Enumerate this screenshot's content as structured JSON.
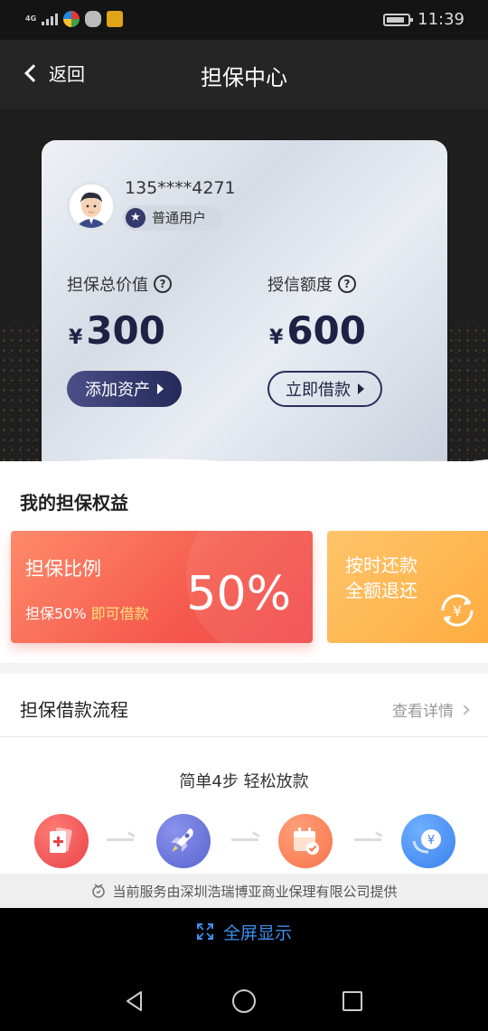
{
  "status": {
    "network": "4G",
    "time": "11:39"
  },
  "header": {
    "back_label": "返回",
    "title": "担保中心"
  },
  "card": {
    "phone": "135****4271",
    "user_level": "普通用户",
    "guarantee": {
      "label": "担保总价值",
      "currency": "¥",
      "value": "300",
      "button": "添加资产"
    },
    "credit": {
      "label": "授信额度",
      "currency": "¥",
      "value": "600",
      "button": "立即借款"
    }
  },
  "benefits": {
    "title": "我的担保权益",
    "ratio": {
      "title": "担保比例",
      "sub_prefix": "担保50%",
      "sub_highlight": "即可借款",
      "big": "50%"
    },
    "repay": {
      "line1": "按时还款",
      "line2": "全额退还"
    }
  },
  "flow": {
    "title": "担保借款流程",
    "link": "查看详情",
    "caption": "简单4步 轻松放款",
    "step_icons": [
      "card-plus-icon",
      "rocket-icon",
      "calendar-check-icon",
      "yen-coin-icon"
    ]
  },
  "provider": {
    "text": "当前服务由深圳浩瑞博亚商业保理有限公司提供"
  },
  "footer": {
    "fullscreen_label": "全屏显示"
  },
  "colors": {
    "accent": "#1e2245",
    "red": "#f55a4e",
    "orange": "#ffab3e",
    "link_blue": "#3d8ff0"
  }
}
